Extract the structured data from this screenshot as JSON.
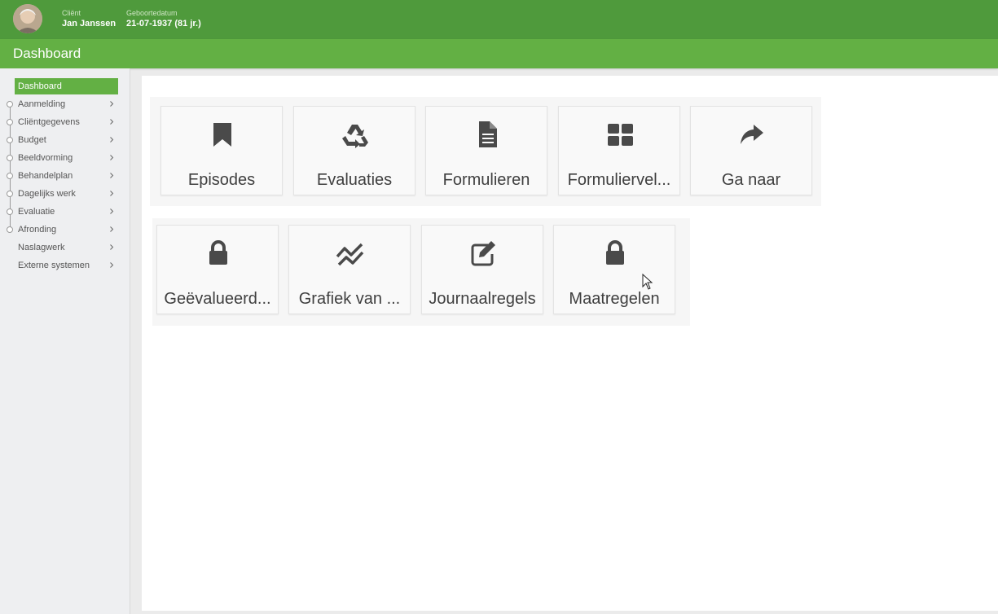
{
  "header": {
    "client_label": "Cliënt",
    "client_name": "Jan Janssen",
    "dob_label": "Geboortedatum",
    "dob_value": "21-07-1937 (81 jr.)"
  },
  "page": {
    "title": "Dashboard"
  },
  "sidebar": {
    "items": [
      {
        "label": "Dashboard",
        "active": true
      },
      {
        "label": "Aanmelding"
      },
      {
        "label": "Cliëntgegevens"
      },
      {
        "label": "Budget"
      },
      {
        "label": "Beeldvorming"
      },
      {
        "label": "Behandelplan"
      },
      {
        "label": "Dagelijks werk"
      },
      {
        "label": "Evaluatie"
      },
      {
        "label": "Afronding"
      },
      {
        "label": "Naslagwerk"
      },
      {
        "label": "Externe systemen"
      }
    ]
  },
  "tiles": {
    "row1": [
      {
        "label": "Episodes",
        "icon": "bookmark-icon"
      },
      {
        "label": "Evaluaties",
        "icon": "recycle-icon"
      },
      {
        "label": "Formulieren",
        "icon": "document-icon"
      },
      {
        "label": "Formuliervel...",
        "icon": "grid-icon"
      },
      {
        "label": "Ga naar",
        "icon": "share-arrow-icon"
      }
    ],
    "row2": [
      {
        "label": "Geëvalueerd...",
        "icon": "lock-icon"
      },
      {
        "label": "Grafiek van ...",
        "icon": "line-chart-icon"
      },
      {
        "label": "Journaalregels",
        "icon": "edit-icon"
      },
      {
        "label": "Maatregelen",
        "icon": "lock-icon"
      }
    ]
  },
  "colors": {
    "header_dark_green": "#4f9a3c",
    "title_green": "#63b044",
    "icon_gray": "#4a4a4a"
  }
}
